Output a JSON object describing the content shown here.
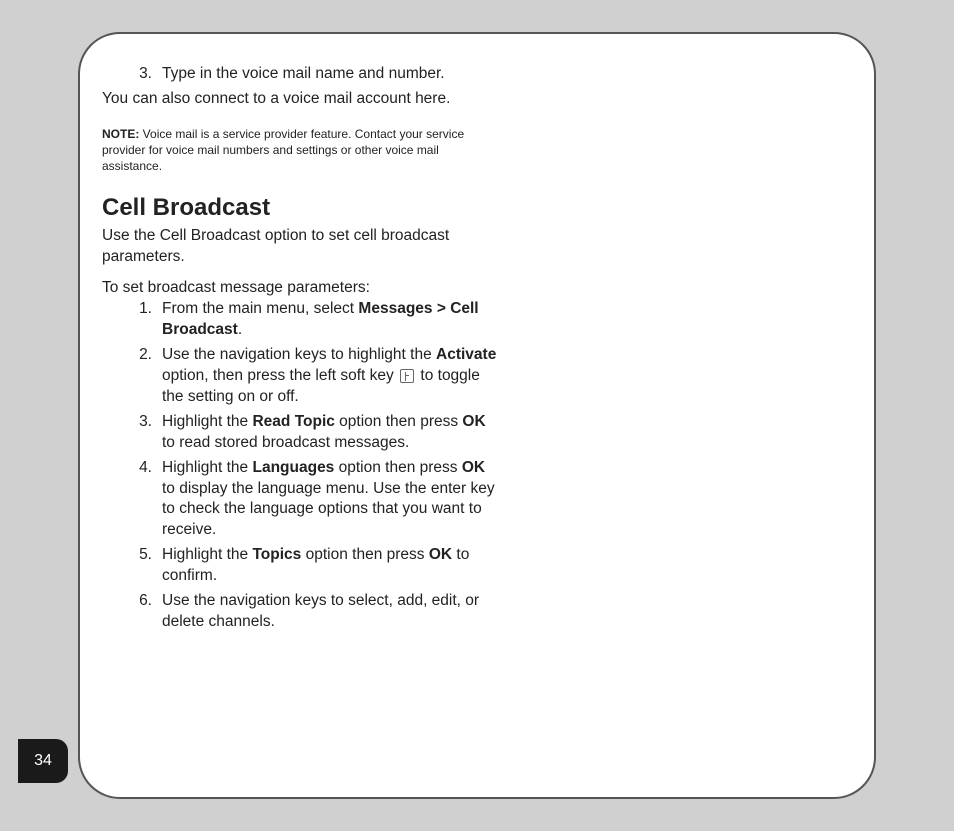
{
  "voicemail": {
    "step3": {
      "num": "3.",
      "text": "Type in the voice mail name and number."
    },
    "connect_text": "You can also connect to a voice mail account here.",
    "note_label": "NOTE:",
    "note_text": " Voice mail is a service provider feature. Contact your service provider for voice mail numbers and settings or other voice mail assistance."
  },
  "cellbroadcast": {
    "heading": "Cell Broadcast",
    "intro": "Use the Cell Broadcast option to set cell broadcast parameters.",
    "lead": "To set broadcast message parameters:",
    "steps": {
      "s1": {
        "num": "1.",
        "pre": "From the main menu, select ",
        "bold": "Messages > Cell Broadcast",
        "post": "."
      },
      "s2": {
        "num": "2.",
        "pre": "Use the navigation keys to highlight the ",
        "bold": "Activate",
        "mid": " option, then press the left soft key ",
        "post": " to toggle the setting on or off."
      },
      "s3": {
        "num": "3.",
        "pre": "Highlight the ",
        "bold1": "Read Topic",
        "mid": " option then press ",
        "bold2": "OK",
        "post": " to read stored broadcast messages."
      },
      "s4": {
        "num": "4.",
        "pre": "Highlight the ",
        "bold1": "Languages",
        "mid": " option then press ",
        "bold2": "OK",
        "post": " to display the language menu. Use the enter key to check the language options that you want to receive."
      },
      "s5": {
        "num": "5.",
        "pre": "Highlight the ",
        "bold1": "Topics",
        "mid": " option then press ",
        "bold2": "OK",
        "post": " to confirm."
      },
      "s6": {
        "num": "6.",
        "text": "Use the navigation keys to select, add, edit, or delete channels."
      }
    }
  },
  "page_number": "34"
}
